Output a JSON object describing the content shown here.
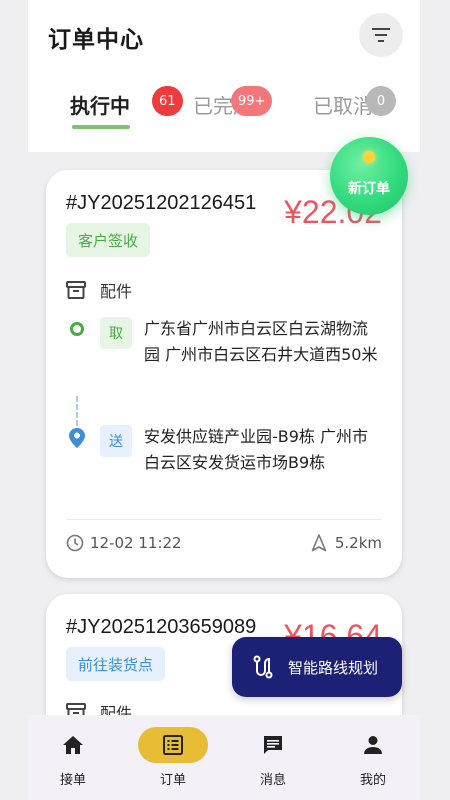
{
  "header": {
    "title": "订单中心",
    "filter_icon": "filter-icon"
  },
  "tabs": [
    {
      "label": "执行中",
      "badge": "61",
      "active": true
    },
    {
      "label": "已完成",
      "badge": "99+",
      "active": false
    },
    {
      "label": "已取消",
      "badge": "0",
      "active": false
    }
  ],
  "floating": {
    "new_order_label": "新订单",
    "route_plan_label": "智能路线规划"
  },
  "orders": [
    {
      "order_no": "#JY20251202126451",
      "price": "¥22.02",
      "status": "客户签收",
      "category": "配件",
      "pickup_tag": "取",
      "pickup_address": "广东省广州市白云区白云湖物流园 广州市白云区石井大道西50米",
      "dropoff_tag": "送",
      "dropoff_address": "安发供应链产业园-B9栋 广州市白云区安发货运市场B9栋",
      "time": "12-02 11:22",
      "distance": "5.2km"
    },
    {
      "order_no": "#JY20251203659089",
      "price": "¥16.64",
      "status": "前往装货点",
      "category": "配件"
    }
  ],
  "bottom_nav": [
    {
      "label": "接单",
      "icon": "home-icon",
      "active": false
    },
    {
      "label": "订单",
      "icon": "list-icon",
      "active": true
    },
    {
      "label": "消息",
      "icon": "message-icon",
      "active": false
    },
    {
      "label": "我的",
      "icon": "person-icon",
      "active": false
    }
  ],
  "colors": {
    "accent_green": "#7cc46f",
    "price_red": "#ee5560",
    "nav_active": "#e8bd35",
    "route_button": "#1d2176"
  }
}
